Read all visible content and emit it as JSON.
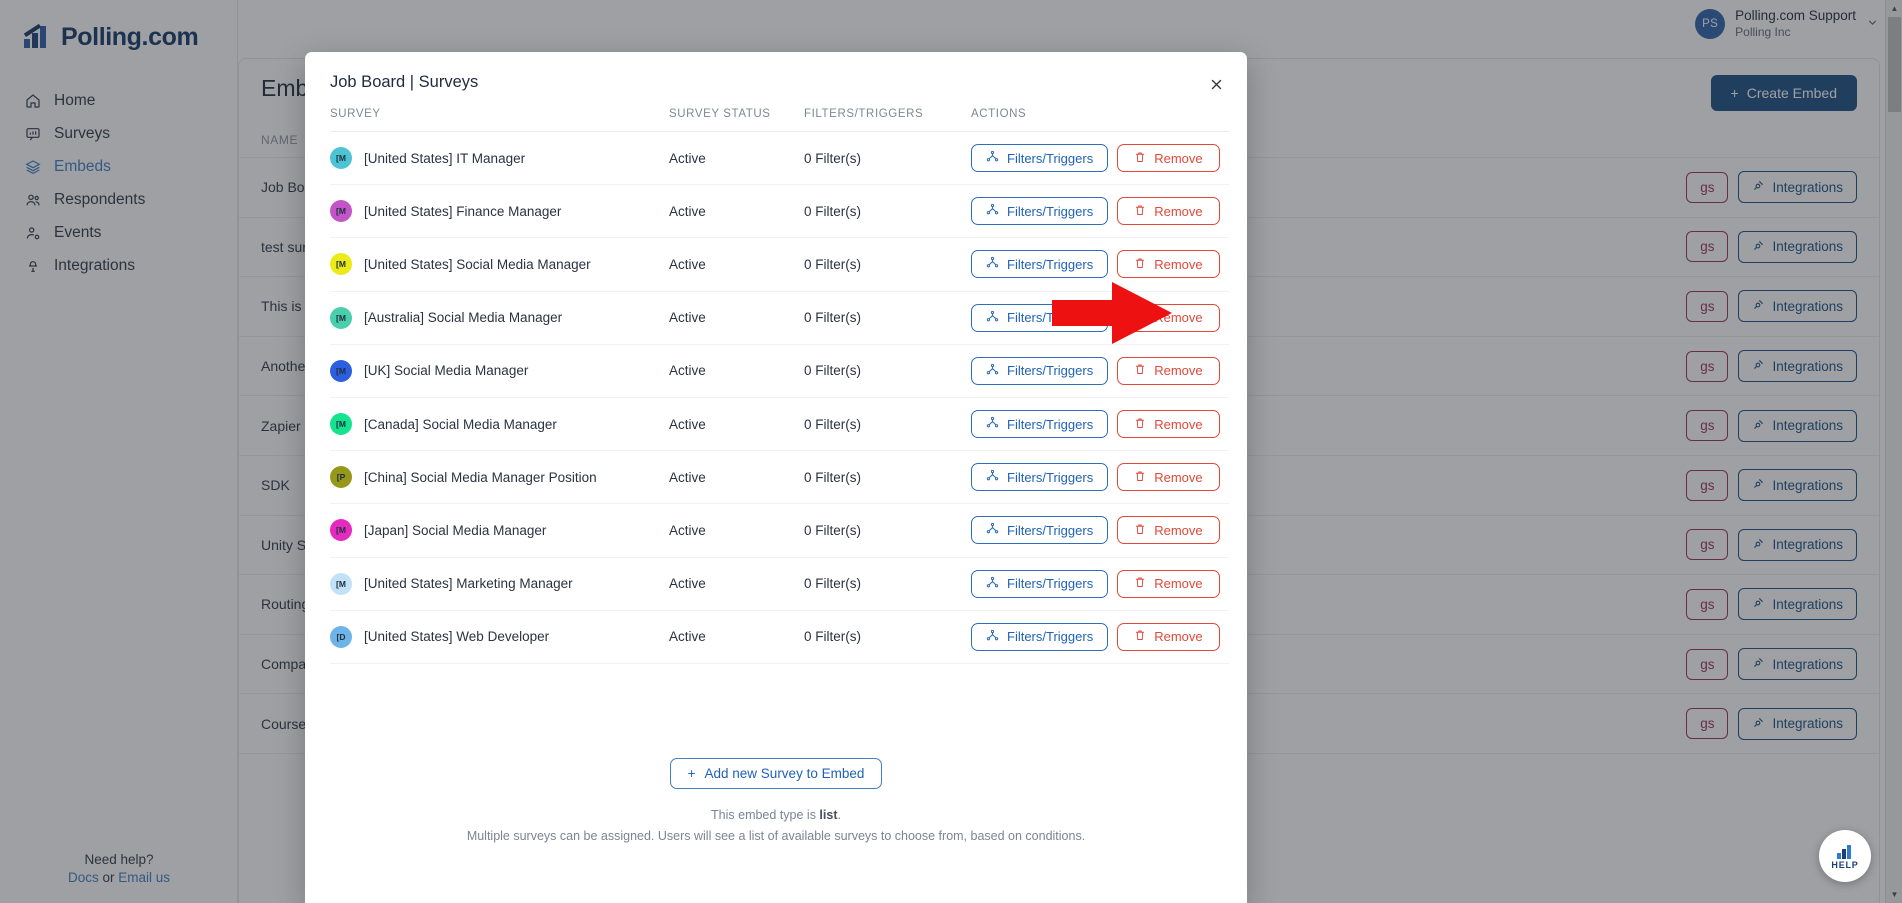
{
  "brand": {
    "name": "Polling.com"
  },
  "sidebar": {
    "items": [
      {
        "label": "Home",
        "icon": "home-icon",
        "active": false
      },
      {
        "label": "Surveys",
        "icon": "survey-icon",
        "active": false
      },
      {
        "label": "Embeds",
        "icon": "layers-icon",
        "active": true
      },
      {
        "label": "Respondents",
        "icon": "users-icon",
        "active": false
      },
      {
        "label": "Events",
        "icon": "user-gear-icon",
        "active": false
      },
      {
        "label": "Integrations",
        "icon": "plug-icon",
        "active": false
      }
    ],
    "help": {
      "title": "Need help?",
      "docs": "Docs",
      "or": " or ",
      "email": "Email us"
    }
  },
  "topbar": {
    "avatar_initials": "PS",
    "user_name": "Polling.com Support",
    "org_name": "Polling Inc",
    "chevron": "chevron-down-icon"
  },
  "page": {
    "title": "Embeds",
    "create_button": "Create Embed",
    "table_header_name": "NAME",
    "row_settings_label": "gs",
    "row_integrations_label": "Integrations",
    "rows": [
      {
        "name": "Job Board"
      },
      {
        "name": "test survey"
      },
      {
        "name": "This is an Emb"
      },
      {
        "name": "Another Zapie"
      },
      {
        "name": "Zapier Embed"
      },
      {
        "name": "SDK"
      },
      {
        "name": "Unity SDK Emb"
      },
      {
        "name": "Routing Embe"
      },
      {
        "name": "Compare Sizes"
      },
      {
        "name": "Course Compl"
      }
    ]
  },
  "help_fab": {
    "label": "HELP"
  },
  "modal": {
    "title": "Job Board | Surveys",
    "close_icon": "close-icon",
    "columns": {
      "survey": "SURVEY",
      "status": "SURVEY STATUS",
      "filters": "FILTERS/TRIGGERS",
      "actions": "ACTIONS"
    },
    "buttons": {
      "filters_triggers": "Filters/Triggers",
      "remove": "Remove",
      "add_survey": "Add new Survey to Embed"
    },
    "rows": [
      {
        "initials": "[M",
        "color": "#4cc4d4",
        "name": "[United States] IT Manager",
        "status": "Active",
        "filters": "0 Filter(s)"
      },
      {
        "initials": "[M",
        "color": "#c455c8",
        "name": "[United States] Finance Manager",
        "status": "Active",
        "filters": "0 Filter(s)"
      },
      {
        "initials": "[M",
        "color": "#eaeb18",
        "name": "[United States] Social Media Manager",
        "status": "Active",
        "filters": "0 Filter(s)"
      },
      {
        "initials": "[M",
        "color": "#49cfae",
        "name": "[Australia] Social Media Manager",
        "status": "Active",
        "filters": "0 Filter(s)"
      },
      {
        "initials": "[M",
        "color": "#2c5fe0",
        "name": "[UK] Social Media Manager",
        "status": "Active",
        "filters": "0 Filter(s)"
      },
      {
        "initials": "[M",
        "color": "#14e48f",
        "name": "[Canada] Social Media Manager",
        "status": "Active",
        "filters": "0 Filter(s)"
      },
      {
        "initials": "[P",
        "color": "#96971b",
        "name": "[China] Social Media Manager Position",
        "status": "Active",
        "filters": "0 Filter(s)"
      },
      {
        "initials": "[M",
        "color": "#e62ac0",
        "name": "[Japan] Social Media Manager",
        "status": "Active",
        "filters": "0 Filter(s)"
      },
      {
        "initials": "[M",
        "color": "#c3e1f7",
        "name": "[United States] Marketing Manager",
        "status": "Active",
        "filters": "0 Filter(s)"
      },
      {
        "initials": "[D",
        "color": "#6fb4e8",
        "name": "[United States] Web Developer",
        "status": "Active",
        "filters": "0 Filter(s)"
      }
    ],
    "footer": {
      "note_prefix": "This embed type is ",
      "note_type": "list",
      "note_suffix": ".",
      "description": "Multiple surveys can be assigned. Users will see a list of available surveys to choose from, based on conditions."
    }
  },
  "annotation": {
    "arrow": "red-pointer-arrow",
    "points_to": "Filters/Triggers"
  },
  "colors": {
    "brand_blue": "#15386b",
    "accent_blue": "#2062b8",
    "danger_red": "#e0483a",
    "primary_button": "#1b4f84",
    "annotation_red": "#ee1111"
  }
}
